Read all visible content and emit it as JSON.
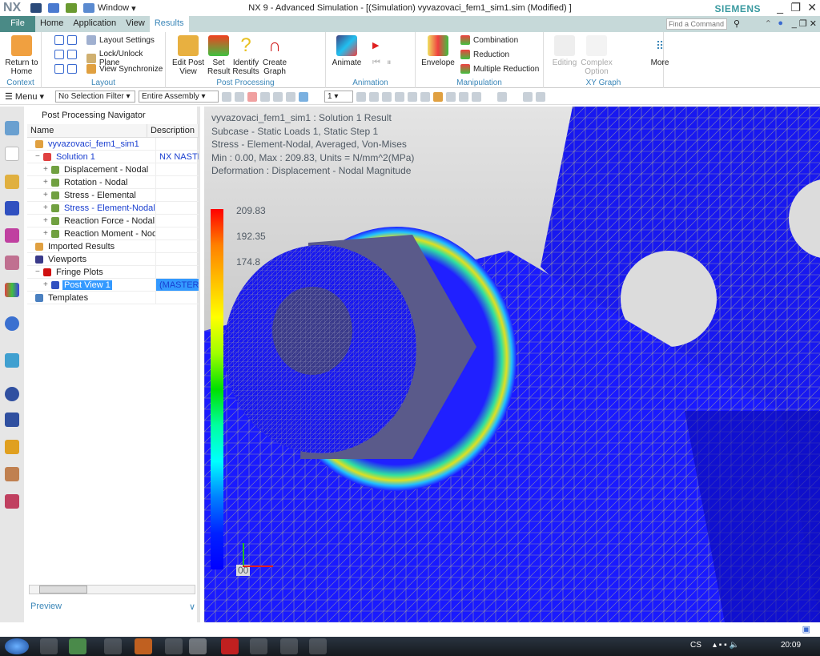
{
  "titlebar": {
    "logo": "NX",
    "window_menu": "Window",
    "title": "NX 9 - Advanced Simulation - [(Simulation) vyvazovaci_fem1_sim1.sim (Modified) ]",
    "brand": "SIEMENS"
  },
  "tabs": [
    "File",
    "Home",
    "Application",
    "View",
    "Results"
  ],
  "active_tab": "Results",
  "find_placeholder": "Find a Command",
  "ribbon": {
    "context": {
      "label": "Context",
      "return_home": "Return to Home"
    },
    "layout": {
      "label": "Layout",
      "items": [
        "Layout Settings",
        "Lock/Unlock Plane",
        "View Synchronize"
      ]
    },
    "post": {
      "label": "Post Processing",
      "buttons": [
        "Edit Post View",
        "Set Result",
        "Identify Results",
        "Create Graph"
      ]
    },
    "animation": {
      "label": "Animation",
      "animate": "Animate"
    },
    "manipulation": {
      "label": "Manipulation",
      "envelope": "Envelope",
      "items": [
        "Combination",
        "Reduction",
        "Multiple Reduction"
      ]
    },
    "xy": {
      "label": "XY Graph",
      "buttons": [
        "Editing",
        "Complex Option"
      ]
    },
    "more": "More"
  },
  "toolbar": {
    "menu": "Menu",
    "filter": "No Selection Filter",
    "scope": "Entire Assembly",
    "layer": "1"
  },
  "navigator": {
    "title": "Post Processing Navigator",
    "columns": [
      "Name",
      "Description"
    ],
    "rows": [
      {
        "name": "vyvazovaci_fem1_sim1",
        "desc": "",
        "blue": true
      },
      {
        "name": "Solution 1",
        "desc": "NX NASTRAN",
        "blue": true
      },
      {
        "name": "Displacement - Nodal",
        "desc": ""
      },
      {
        "name": "Rotation - Nodal",
        "desc": ""
      },
      {
        "name": "Stress - Elemental",
        "desc": ""
      },
      {
        "name": "Stress - Element-Nodal",
        "desc": "",
        "blue": true
      },
      {
        "name": "Reaction Force - Nodal",
        "desc": ""
      },
      {
        "name": "Reaction Moment - Nodal",
        "desc": ""
      },
      {
        "name": "Imported Results",
        "desc": ""
      },
      {
        "name": "Viewports",
        "desc": ""
      },
      {
        "name": "Fringe Plots",
        "desc": ""
      },
      {
        "name": "Post View 1",
        "desc": "(MASTER) S",
        "selected": true
      },
      {
        "name": "Templates",
        "desc": ""
      }
    ],
    "preview": "Preview"
  },
  "viewport": {
    "info": [
      "vyvazovaci_fem1_sim1 : Solution 1 Result",
      "Subcase - Static Loads 1, Static Step 1",
      "Stress - Element-Nodal, Averaged, Von-Mises",
      "Min : 0.00, Max : 209.83, Units = N/mm^2(MPa)",
      "Deformation : Displacement - Nodal Magnitude"
    ],
    "legend_labels": [
      "209.83",
      "192.35",
      "174.8",
      "00"
    ],
    "legend_min": 0.0,
    "legend_max": 209.83
  },
  "taskbar": {
    "lang": "CS",
    "time": "20:09"
  },
  "colors": {
    "ribbon_tab_bg": "#c6d9d9",
    "accent": "#3a86b8",
    "mesh_blue": "#1a1aff",
    "selection": "#3399ff"
  }
}
